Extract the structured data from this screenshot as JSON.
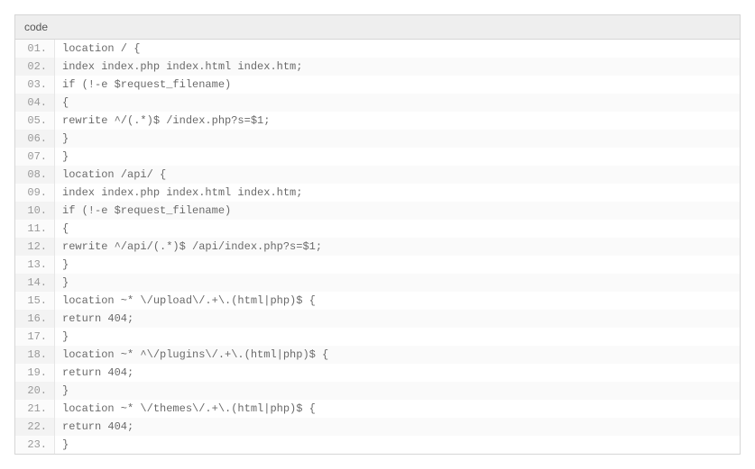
{
  "header": {
    "title": "code"
  },
  "code": {
    "lines": [
      {
        "num": "01.",
        "text": "location / {"
      },
      {
        "num": "02.",
        "text": "index index.php index.html index.htm;"
      },
      {
        "num": "03.",
        "text": "if (!-e $request_filename)"
      },
      {
        "num": "04.",
        "text": "{"
      },
      {
        "num": "05.",
        "text": "rewrite ^/(.*)$ /index.php?s=$1;"
      },
      {
        "num": "06.",
        "text": "}"
      },
      {
        "num": "07.",
        "text": "}"
      },
      {
        "num": "08.",
        "text": "location /api/ {"
      },
      {
        "num": "09.",
        "text": "index index.php index.html index.htm;"
      },
      {
        "num": "10.",
        "text": "if (!-e $request_filename)"
      },
      {
        "num": "11.",
        "text": "{"
      },
      {
        "num": "12.",
        "text": "rewrite ^/api/(.*)$ /api/index.php?s=$1;"
      },
      {
        "num": "13.",
        "text": "}"
      },
      {
        "num": "14.",
        "text": "}"
      },
      {
        "num": "15.",
        "text": "location ~* \\/upload\\/.+\\.(html|php)$ {"
      },
      {
        "num": "16.",
        "text": "return 404;"
      },
      {
        "num": "17.",
        "text": "}"
      },
      {
        "num": "18.",
        "text": "location ~* ^\\/plugins\\/.+\\.(html|php)$ {"
      },
      {
        "num": "19.",
        "text": "return 404;"
      },
      {
        "num": "20.",
        "text": "}"
      },
      {
        "num": "21.",
        "text": "location ~* \\/themes\\/.+\\.(html|php)$ {"
      },
      {
        "num": "22.",
        "text": "return 404;"
      },
      {
        "num": "23.",
        "text": "}"
      }
    ]
  }
}
